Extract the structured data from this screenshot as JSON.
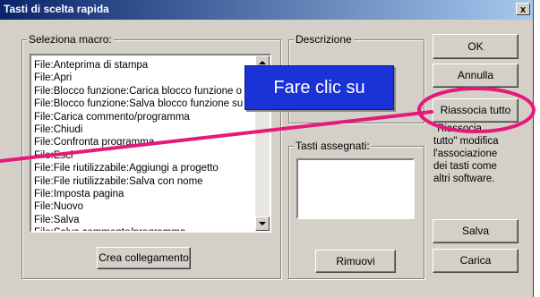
{
  "window": {
    "title": "Tasti di scelta rapida",
    "close_label": "x"
  },
  "macro_group": {
    "label": "Seleziona macro:",
    "items": [
      "File:Anteprima di stampa",
      "File:Apri",
      "File:Blocco funzione:Carica blocco funzione o",
      "File:Blocco funzione:Salva blocco funzione su",
      "File:Carica commento/programma",
      "File:Chiudi",
      "File:Confronta programma",
      "File:Esci",
      "File:File riutilizzabile:Aggiungi a progetto",
      "File:File riutilizzabile:Salva con nome",
      "File:Imposta pagina",
      "File:Nuovo",
      "File:Salva",
      "File:Salva commento/programma"
    ],
    "create_link_button": "Crea collegamento"
  },
  "description_group": {
    "label": "Descrizione",
    "text": "\"Riassocia\ntutto\" modifica\nl'associazione\ndei tasti come\naltri software."
  },
  "assigned_group": {
    "label": "Tasti assegnati:",
    "remove_button": "Rimuovi"
  },
  "buttons": {
    "ok": "OK",
    "cancel": "Annulla",
    "reassign_all": "Riassocia tutto",
    "save": "Salva",
    "load": "Carica"
  },
  "tooltip": {
    "text": "Fare clic su"
  },
  "colors": {
    "title_gradient_start": "#0a246a",
    "tooltip_bg": "#1b33d6",
    "callout_magenta": "#e6197a"
  }
}
